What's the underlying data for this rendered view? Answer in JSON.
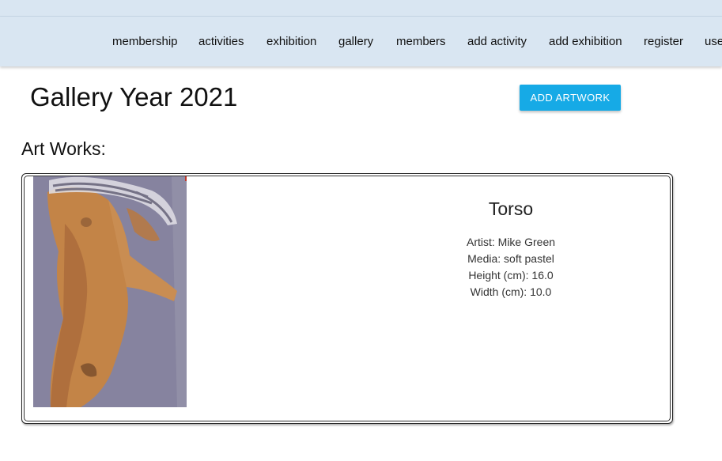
{
  "nav": {
    "items": [
      {
        "label": "membership"
      },
      {
        "label": "activities"
      },
      {
        "label": "exhibition"
      },
      {
        "label": "gallery"
      },
      {
        "label": "members"
      },
      {
        "label": "add activity"
      },
      {
        "label": "add exhibition"
      },
      {
        "label": "register"
      },
      {
        "label": "use"
      }
    ]
  },
  "page": {
    "title": "Gallery Year 2021",
    "add_button_label": "ADD ARTWORK",
    "section_title": "Art Works:"
  },
  "artworks": [
    {
      "title": "Torso",
      "artist": "Artist: Mike Green",
      "media": "Media: soft pastel",
      "height": "Height (cm): 16.0",
      "width": "Width (cm): 10.0"
    }
  ],
  "colors": {
    "navbar_bg": "#d9e6f2",
    "button_bg": "#16aae6",
    "button_text": "#ffffff"
  }
}
